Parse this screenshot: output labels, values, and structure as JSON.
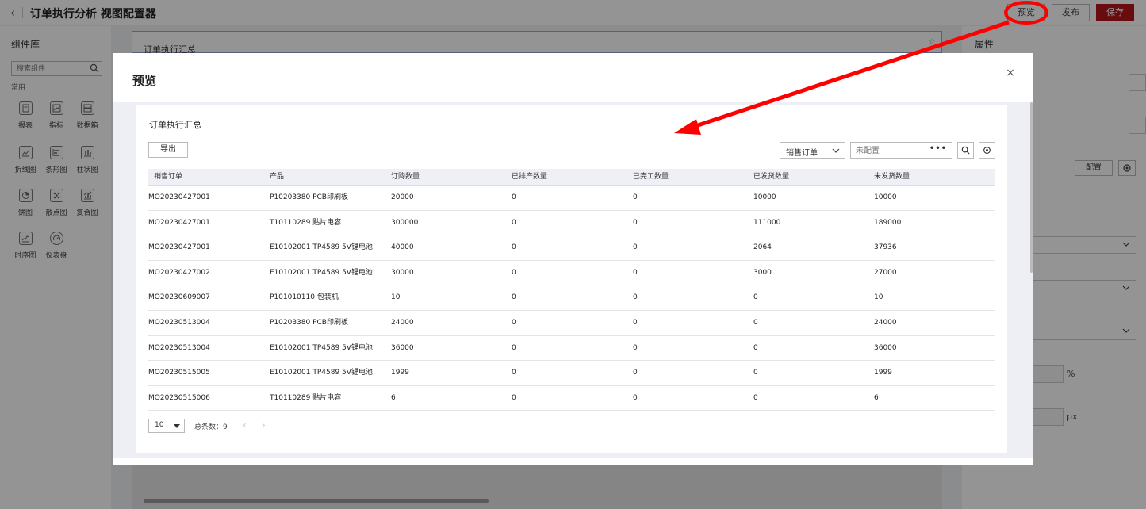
{
  "app": {
    "title": "订单执行分析 视图配置器",
    "back_icon": "chevron-left-icon",
    "buttons": {
      "preview": "预览",
      "publish": "发布",
      "save": "保存"
    },
    "colors": {
      "save": "#b3151b",
      "annotation": "#ff0000"
    }
  },
  "library": {
    "title": "组件库",
    "search_placeholder": "搜索组件",
    "group": "常用",
    "items": [
      {
        "label": "报表",
        "icon": "report-icon"
      },
      {
        "label": "指标",
        "icon": "indicator-icon"
      },
      {
        "label": "数据箱",
        "icon": "data-box-icon"
      },
      {
        "label": "折线图",
        "icon": "line-chart-icon"
      },
      {
        "label": "条形图",
        "icon": "bar-h-chart-icon"
      },
      {
        "label": "柱状图",
        "icon": "column-chart-icon"
      },
      {
        "label": "饼图",
        "icon": "pie-chart-icon"
      },
      {
        "label": "散点图",
        "icon": "scatter-chart-icon"
      },
      {
        "label": "复合图",
        "icon": "combo-chart-icon"
      },
      {
        "label": "时序图",
        "icon": "timeseries-chart-icon"
      },
      {
        "label": "仪表盘",
        "icon": "gauge-icon"
      }
    ]
  },
  "canvas": {
    "card_title": "订单执行汇总"
  },
  "properties": {
    "title": "属性",
    "config_button": "配置",
    "units": {
      "percent": "%",
      "px": "px"
    }
  },
  "modal": {
    "title": "预览",
    "close": "×",
    "card_title": "订单执行汇总",
    "export_button": "导出",
    "filter_select": "销售订单",
    "config_placeholder": "未配置",
    "more": "•••",
    "table": {
      "columns": [
        "销售订单",
        "产品",
        "订购数量",
        "已排产数量",
        "已完工数量",
        "已发货数量",
        "未发货数量"
      ],
      "rows": [
        [
          "MO20230427001",
          "P10203380 PCB印刷板",
          "20000",
          "0",
          "0",
          "10000",
          "10000"
        ],
        [
          "MO20230427001",
          "T10110289 贴片电容",
          "300000",
          "0",
          "0",
          "111000",
          "189000"
        ],
        [
          "MO20230427001",
          "E10102001 TP4589 5V锂电池",
          "40000",
          "0",
          "0",
          "2064",
          "37936"
        ],
        [
          "MO20230427002",
          "E10102001 TP4589 5V锂电池",
          "30000",
          "0",
          "0",
          "3000",
          "27000"
        ],
        [
          "MO20230609007",
          "P101010110 包装机",
          "10",
          "0",
          "0",
          "0",
          "10"
        ],
        [
          "MO20230513004",
          "P10203380 PCB印刷板",
          "24000",
          "0",
          "0",
          "0",
          "24000"
        ],
        [
          "MO20230513004",
          "E10102001 TP4589 5V锂电池",
          "36000",
          "0",
          "0",
          "0",
          "36000"
        ],
        [
          "MO20230515005",
          "E10102001 TP4589 5V锂电池",
          "1999",
          "0",
          "0",
          "0",
          "1999"
        ],
        [
          "MO20230515006",
          "T10110289 贴片电容",
          "6",
          "0",
          "0",
          "0",
          "6"
        ]
      ]
    },
    "pagination": {
      "page_size": "10",
      "total": "总条数：9",
      "prev": "‹",
      "next": "›"
    }
  }
}
